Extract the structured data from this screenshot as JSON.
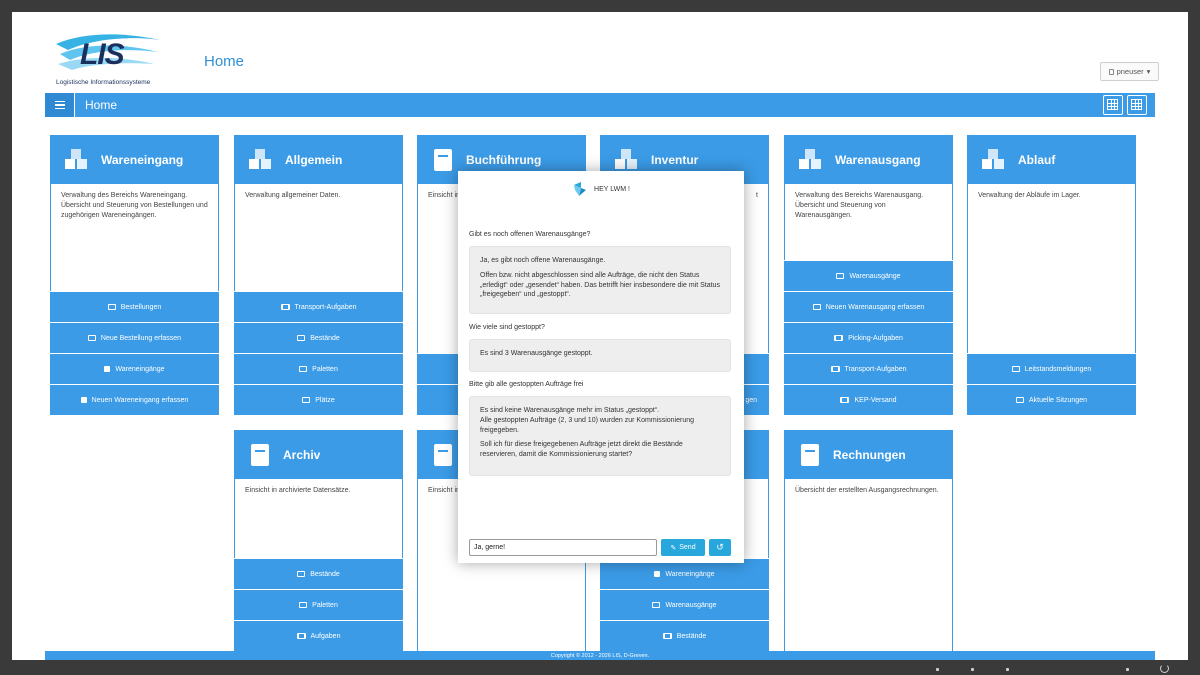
{
  "header": {
    "logo_text": "LIS",
    "logo_subtitle": "Logistische Informationssysteme",
    "page_title": "Home",
    "user": "pneuser"
  },
  "navbar": {
    "title": "Home"
  },
  "cards": {
    "wareneingang": {
      "title": "Wareneingang",
      "desc": "Verwaltung des Bereichs Wareneingang. Übersicht und Steuerung von Bestellungen und zugehörigen Wareneingängen.",
      "actions": [
        "Bestellungen",
        "Neue Bestellung erfassen",
        "Wareneingänge",
        "Neuen Wareneingang erfassen"
      ]
    },
    "allgemein": {
      "title": "Allgemein",
      "desc": "Verwaltung allgemeiner Daten.",
      "actions": [
        "Transport-Aufgaben",
        "Bestände",
        "Paletten",
        "Plätze"
      ]
    },
    "buchfuehrung": {
      "title": "Buchführung",
      "desc": "Einsicht in"
    },
    "inventur": {
      "title": "Inventur",
      "desc": "t",
      "action_fragment": "gen"
    },
    "warenausgang": {
      "title": "Warenausgang",
      "desc": "Verwaltung des Bereichs Warenausgang. Übersicht und Steuerung von Warenausgängen.",
      "actions": [
        "Warenausgänge",
        "Neuen Warenausgang erfassen",
        "Picking-Aufgaben",
        "Transport-Aufgaben",
        "KEP-Versand"
      ]
    },
    "ablauf": {
      "title": "Ablauf",
      "desc": "Verwaltung der Abläufe im Lager.",
      "actions": [
        "Leitstandsmeldungen",
        "Aktuelle Sitzungen"
      ]
    },
    "archiv": {
      "title": "Archiv",
      "desc": "Einsicht in archivierte Datensätze.",
      "actions": [
        "Bestände",
        "Paletten",
        "Aufgaben"
      ]
    },
    "card8": {
      "desc": "Einsicht in"
    },
    "card9": {
      "actions": [
        "Wareneingänge",
        "Warenausgänge",
        "Bestände"
      ]
    },
    "rechnungen": {
      "title": "Rechnungen",
      "desc": "Übersicht der erstellten Ausgangsrechnungen."
    }
  },
  "chat": {
    "header": "HEY LWM !",
    "messages": {
      "q1": "Gibt es noch offenen Warenausgänge?",
      "a1_p1": "Ja, es gibt noch offene Warenausgänge.",
      "a1_p2": "Offen bzw. nicht abgeschlossen sind alle Aufträge, die nicht den Status „erledigt“ oder „gesendet“ haben. Das betrifft hier insbesondere die mit Status „freigegeben“ und „gestoppt“.",
      "q2": "Wie viele sind gestoppt?",
      "a2": "Es sind 3 Warenausgänge gestoppt.",
      "q3": "Bitte gib alle gestoppten Aufträge frei",
      "a3_p1_l1": "Es sind keine Warenausgänge mehr im Status „gestoppt“.",
      "a3_p1_l2": "Alle gestoppten Aufträge (2, 3 und 10) wurden zur Kommissionierung freigegeben.",
      "a3_p2": "Soll ich für diese freigegebenen Aufträge jetzt direkt die Bestände reservieren, damit die Kommissionierung startet?"
    },
    "input_value": "Ja, gerne!",
    "send_label": "Send",
    "reset_label": "↺"
  },
  "footer": {
    "text": "Copyright © 2012 - 2026 LIS, D-Greven."
  },
  "colors": {
    "primary": "#3b9be6",
    "primary_dark": "#2f89d3",
    "accent": "#27a7dc",
    "heading": "#2e8fd6"
  }
}
